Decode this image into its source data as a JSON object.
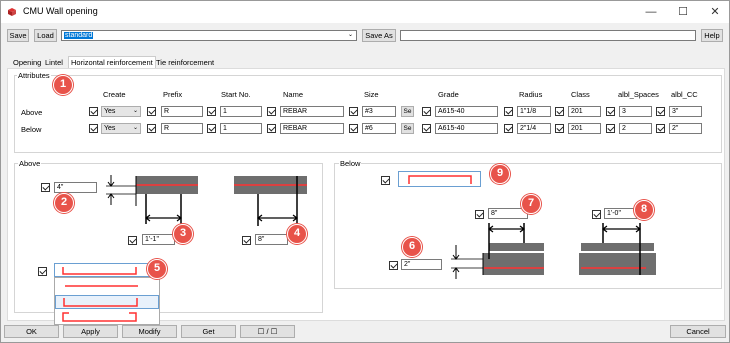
{
  "window": {
    "title": "CMU Wall opening"
  },
  "toolbar": {
    "save": "Save",
    "load": "Load",
    "preset": "standard",
    "save_as": "Save As",
    "save_as_value": "",
    "help": "Help"
  },
  "tabs": [
    "Opening",
    "Lintel",
    "Horizontal reinforcement",
    "Tie reinforcement"
  ],
  "attributes": {
    "group_label": "Attributes",
    "headers": [
      "Create",
      "Prefix",
      "Start No.",
      "Name",
      "Size",
      "Grade",
      "Radius",
      "Class",
      "albl_Spaces",
      "albl_CC"
    ],
    "rows": [
      {
        "label": "Above",
        "create": "Yes",
        "prefix": "R",
        "start_no": "1",
        "name": "REBAR",
        "size": "#3",
        "grade": "A615-40",
        "radius": "1\"1/8",
        "class": "201",
        "spaces": "3",
        "cc": "3\""
      },
      {
        "label": "Below",
        "create": "Yes",
        "prefix": "R",
        "start_no": "1",
        "name": "REBAR",
        "size": "#6",
        "grade": "A615-40",
        "radius": "2\"1/4",
        "class": "201",
        "spaces": "2",
        "cc": "2\""
      }
    ],
    "se_label": "Se"
  },
  "above": {
    "group_label": "Above",
    "offset": "4\"",
    "dist1": "1'-1\"",
    "dist2": "8\""
  },
  "below": {
    "group_label": "Below",
    "dist1": "8\"",
    "dist2": "1'-0\"",
    "offset": "2\""
  },
  "badges": [
    "1",
    "2",
    "3",
    "4",
    "5",
    "6",
    "7",
    "8",
    "9"
  ],
  "bottom": {
    "ok": "OK",
    "apply": "Apply",
    "modify": "Modify",
    "get": "Get",
    "toggle": "☐ / ☐",
    "cancel": "Cancel"
  },
  "colors": {
    "badge": "#e8534a",
    "rebar": "#e03030",
    "block": "#707070"
  }
}
